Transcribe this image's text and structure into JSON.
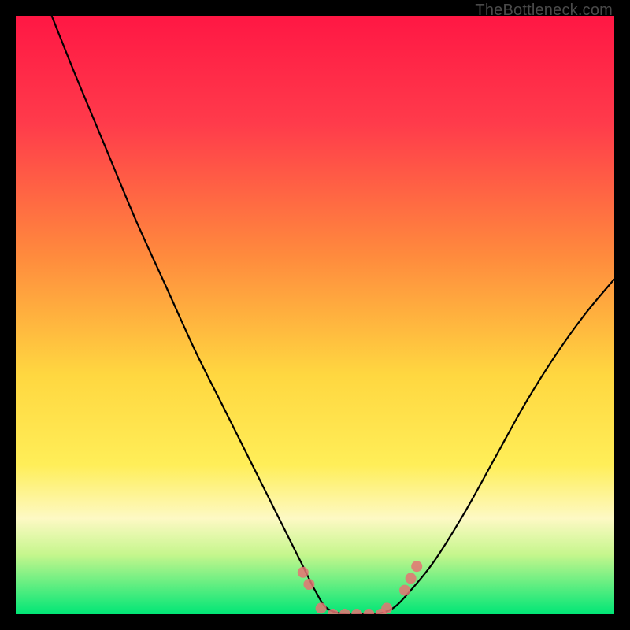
{
  "watermark": "TheBottleneck.com",
  "chart_data": {
    "type": "line",
    "title": "",
    "xlabel": "",
    "ylabel": "",
    "xlim": [
      0,
      100
    ],
    "ylim": [
      0,
      100
    ],
    "background_gradient": {
      "stops": [
        {
          "offset": 0,
          "color": "#ff1744"
        },
        {
          "offset": 18,
          "color": "#ff3b4b"
        },
        {
          "offset": 40,
          "color": "#ff8a3d"
        },
        {
          "offset": 60,
          "color": "#ffd740"
        },
        {
          "offset": 75,
          "color": "#ffee58"
        },
        {
          "offset": 84,
          "color": "#fdf9c4"
        },
        {
          "offset": 90,
          "color": "#c6f68d"
        },
        {
          "offset": 100,
          "color": "#00e676"
        }
      ]
    },
    "series": [
      {
        "name": "bottleneck-curve",
        "color": "#000000",
        "x": [
          6,
          10,
          15,
          20,
          25,
          30,
          35,
          40,
          45,
          48,
          50,
          52,
          55,
          58,
          60,
          63,
          66,
          70,
          75,
          80,
          85,
          90,
          95,
          100
        ],
        "y": [
          100,
          90,
          78,
          66,
          55,
          44,
          34,
          24,
          14,
          8,
          4,
          1,
          0,
          0,
          0,
          1,
          4,
          9,
          17,
          26,
          35,
          43,
          50,
          56
        ]
      }
    ],
    "markers": {
      "name": "highlight-points",
      "color": "#e57373",
      "radius": 7,
      "points": [
        {
          "x": 48,
          "y": 7
        },
        {
          "x": 49,
          "y": 5
        },
        {
          "x": 51,
          "y": 1
        },
        {
          "x": 53,
          "y": 0
        },
        {
          "x": 55,
          "y": 0
        },
        {
          "x": 57,
          "y": 0
        },
        {
          "x": 59,
          "y": 0
        },
        {
          "x": 61,
          "y": 0
        },
        {
          "x": 62,
          "y": 1
        },
        {
          "x": 65,
          "y": 4
        },
        {
          "x": 66,
          "y": 6
        },
        {
          "x": 67,
          "y": 8
        }
      ]
    }
  }
}
